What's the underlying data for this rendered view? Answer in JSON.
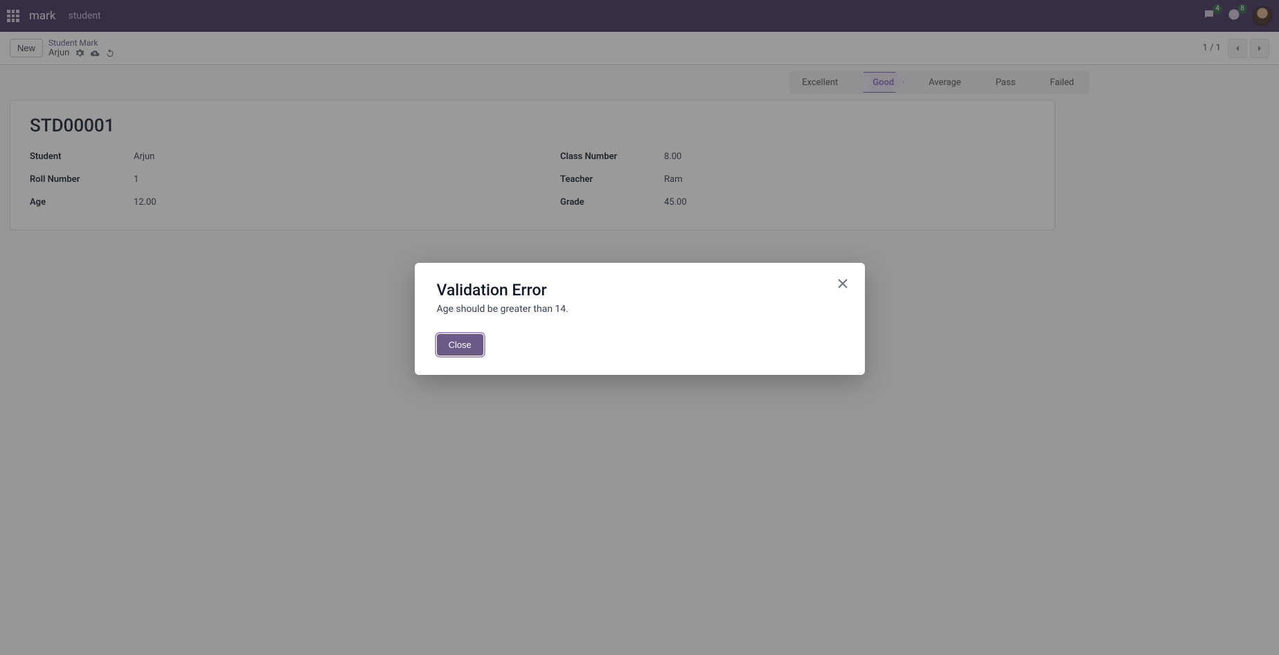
{
  "navbar": {
    "brand": "mark",
    "module": "student",
    "messages_badge": "4",
    "activity_badge": "8"
  },
  "toolbar": {
    "new_button": "New",
    "breadcrumb_top": "Student Mark",
    "breadcrumb_bottom": "Arjun",
    "pager": "1 / 1"
  },
  "status_steps": [
    "Excellent",
    "Good",
    "Average",
    "Pass",
    "Failed"
  ],
  "record": {
    "title": "STD00001",
    "fields_left": [
      {
        "label": "Student",
        "value": "Arjun"
      },
      {
        "label": "Roll Number",
        "value": "1"
      },
      {
        "label": "Age",
        "value": "12.00"
      }
    ],
    "fields_right": [
      {
        "label": "Class Number",
        "value": "8.00"
      },
      {
        "label": "Teacher",
        "value": "Ram"
      },
      {
        "label": "Grade",
        "value": "45.00"
      }
    ]
  },
  "modal": {
    "title": "Validation Error",
    "message": "Age should be greater than 14.",
    "close_button": "Close"
  }
}
